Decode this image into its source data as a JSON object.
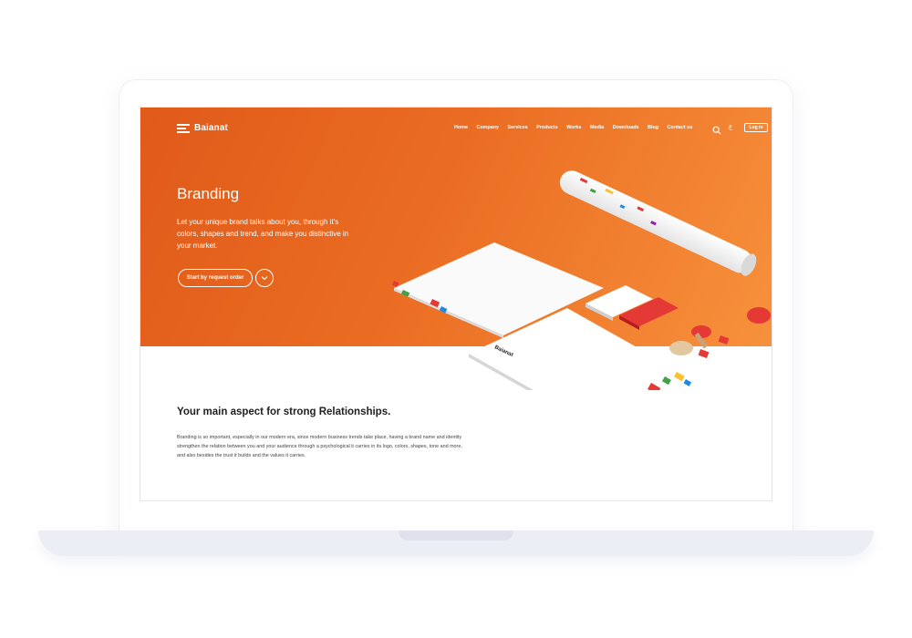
{
  "brand": {
    "name": "Baianat"
  },
  "nav": {
    "items": [
      "Home",
      "Company",
      "Services",
      "Products",
      "Works",
      "Media",
      "Downloads",
      "Blog",
      "Contact us"
    ],
    "lang_toggle": "ع",
    "login_label": "Log in"
  },
  "hero": {
    "title": "Branding",
    "description": "Let your unique brand talks about you, through it's colors, shapes and trend, and make you distinctive in your market.",
    "cta_label": "Start by request order",
    "mockup_brand": "Baianat"
  },
  "section": {
    "title": "Your main aspect for strong Relationships.",
    "body": "Branding is so important, especially in our modern era, since modern business trends take place, having a brand name and identity strengthen the relation between you and your audience through a psychological it carries in its logo, colors, shapes, tone and more, and also besides the trust it builds and the values it carries."
  },
  "colors": {
    "hero_start": "#e05a1a",
    "hero_end": "#f7913c",
    "stamp_red": "#e53935",
    "text_dark": "#222222"
  },
  "icons": [
    "logo-mark-icon",
    "search-icon",
    "chevron-down-icon"
  ]
}
